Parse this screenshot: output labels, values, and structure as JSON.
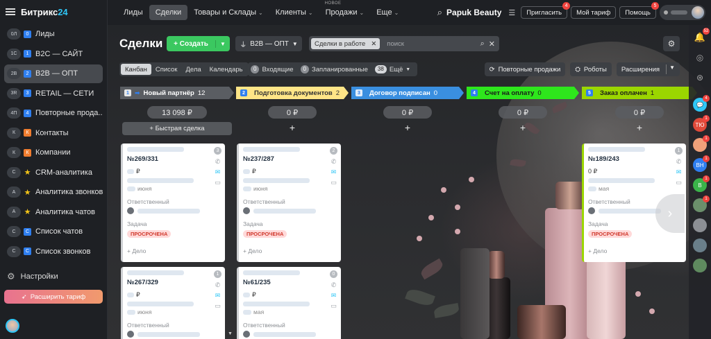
{
  "brand": {
    "name": "Битрикс",
    "suffix": "24"
  },
  "sidebar": {
    "items": [
      {
        "badge": "0Л",
        "icon": "0",
        "icon_color": "#2f7ff0",
        "label": "Лиды"
      },
      {
        "badge": "1С",
        "icon": "1",
        "icon_color": "#2f7ff0",
        "label": "В2С — САЙТ"
      },
      {
        "badge": "2В",
        "icon": "2",
        "icon_color": "#2f7ff0",
        "label": "В2В — ОПТ",
        "active": true
      },
      {
        "badge": "3R",
        "icon": "3",
        "icon_color": "#2f7ff0",
        "label": "RETAIL — СЕТИ"
      },
      {
        "badge": "4П",
        "icon": "4",
        "icon_color": "#2f7ff0",
        "label": "Повторные прода..."
      },
      {
        "badge": "К",
        "icon": "К",
        "icon_color": "#f07d2f",
        "label": "Контакты"
      },
      {
        "badge": "К",
        "icon": "К",
        "icon_color": "#f07d2f",
        "label": "Компании"
      },
      {
        "badge": "С",
        "icon": "★",
        "icon_color": "transparent",
        "label": "CRM-аналитика"
      },
      {
        "badge": "А",
        "icon": "★",
        "icon_color": "transparent",
        "label": "Аналитика звонков"
      },
      {
        "badge": "А",
        "icon": "★",
        "icon_color": "transparent",
        "label": "Аналитика чатов"
      },
      {
        "badge": "С",
        "icon": "С",
        "icon_color": "#2f7ff0",
        "label": "Список чатов"
      },
      {
        "badge": "С",
        "icon": "С",
        "icon_color": "#2f7ff0",
        "label": "Список звонков"
      }
    ],
    "settings_label": "Настройки",
    "upgrade_label": "Расширить тариф"
  },
  "topnav": {
    "items": [
      {
        "label": "Лиды"
      },
      {
        "label": "Сделки",
        "active": true
      },
      {
        "label": "Товары и Склады",
        "caret": true
      },
      {
        "label": "Клиенты",
        "caret": true
      },
      {
        "label": "Продажи",
        "caret": true,
        "tag": "НОВОЕ"
      },
      {
        "label": "Еще",
        "caret": true
      }
    ],
    "company": "Papuk Beauty",
    "invite_label": "Пригласить",
    "invite_count": "4",
    "plan_label": "Мой тариф",
    "help_label": "Помощь",
    "help_count": "5"
  },
  "header": {
    "title": "Сделки",
    "create_label": "+ Создать",
    "pipeline_label": "B2B — ОПТ",
    "filter_chip": "Сделки в работе",
    "search_placeholder": "поиск"
  },
  "views": {
    "tabs": [
      "Канбан",
      "Список",
      "Дела",
      "Календарь"
    ],
    "incoming_count": "0",
    "incoming_label": "Входящие",
    "planned_count": "0",
    "planned_label": "Запланированные",
    "more_count": "38",
    "more_label": "Ещё",
    "repeat_label": "Повторные продажи",
    "robots_label": "Роботы",
    "extensions_label": "Расширения"
  },
  "kanban": {
    "columns": [
      {
        "num": "1",
        "name": "Новый партнёр",
        "count": "12",
        "color": "#5a5d62",
        "text": "#fff",
        "sum": "13 098 ₽",
        "quick_label": "+ Быстрая сделка"
      },
      {
        "num": "2",
        "name": "Подготовка документов",
        "count": "2",
        "color": "#ffe587",
        "text": "#333",
        "sum": "0 ₽"
      },
      {
        "num": "3",
        "name": "Договор подписан",
        "count": "0",
        "color": "#3a8fe0",
        "text": "#fff",
        "sum": "0 ₽"
      },
      {
        "num": "4",
        "name": "Счет на оплату",
        "count": "0",
        "color": "#2ee61c",
        "text": "#1a1a1a",
        "sum": "0 ₽"
      },
      {
        "num": "5",
        "name": "Заказ оплачен",
        "count": "1",
        "color": "#9bd600",
        "text": "#1a1a1a",
        "sum": "0 ₽"
      }
    ],
    "cards": {
      "c1": {
        "title": "№269/331",
        "amount_sign": "₽",
        "date": "июня",
        "badge": "3",
        "resp_label": "Ответственный",
        "task_label": "Задача",
        "overdue": "ПРОСРОЧЕНА",
        "deal_label": "+ Дело"
      },
      "c2": {
        "title": "№237/287",
        "amount_sign": "₽",
        "date": "июня",
        "badge": "2",
        "resp_label": "Ответственный",
        "task_label": "Задача",
        "overdue": "ПРОСРОЧЕНА",
        "deal_label": "+ Дело"
      },
      "c3": {
        "title": "№189/243",
        "amount": "0 ₽",
        "date": "мая",
        "badge": "1",
        "resp_label": "Ответственный",
        "task_label": "Задача",
        "overdue": "ПРОСРОЧЕНА",
        "deal_label": "+ Дело"
      },
      "c4": {
        "title": "№267/329",
        "amount_sign": "₽",
        "date": "июня",
        "badge": "1",
        "resp_label": "Ответственный"
      },
      "c5": {
        "title": "№61/235",
        "amount_sign": "₽",
        "date": "мая",
        "badge": "0",
        "resp_label": "Ответственный"
      }
    }
  },
  "rail": {
    "notif_count": "52",
    "chat_count": "4",
    "avatars": [
      {
        "initials": "ТЮ",
        "color": "#e04a3a",
        "count": "1"
      },
      {
        "initials": "",
        "color": "#f0a17a",
        "count": "1"
      },
      {
        "initials": "ВН",
        "color": "#2f7ff0",
        "count": "1"
      },
      {
        "initials": "В",
        "color": "#3bb34a",
        "count": "1"
      },
      {
        "initials": "",
        "color": "#6b8f6b",
        "count": "1"
      },
      {
        "initials": "",
        "color": "#8c8f94",
        "count": ""
      },
      {
        "initials": "",
        "color": "#6a7f8a",
        "count": ""
      },
      {
        "initials": "",
        "color": "#5f8a5f",
        "count": ""
      }
    ]
  }
}
